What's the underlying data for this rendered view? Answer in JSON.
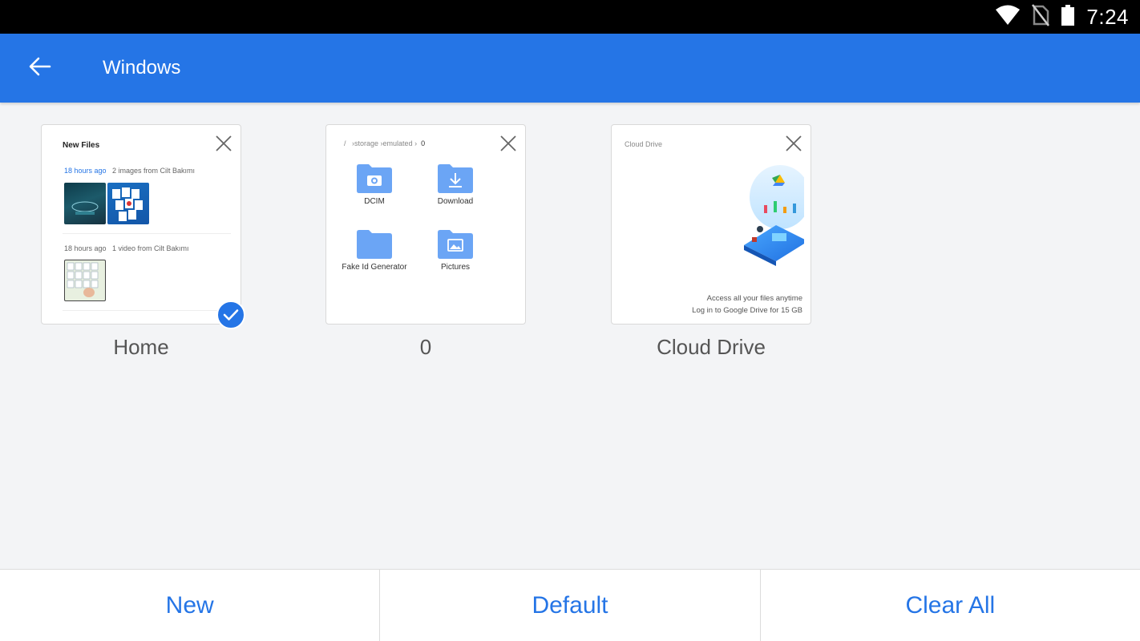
{
  "status_bar": {
    "time": "7:24",
    "icons": [
      "wifi-icon",
      "no-sim-icon",
      "battery-icon"
    ]
  },
  "app_bar": {
    "title": "Windows",
    "back_icon": "arrow-back-icon"
  },
  "windows": [
    {
      "label": "Home",
      "selected": true,
      "preview": {
        "title": "New Files",
        "groups": [
          {
            "time": "18 hours ago",
            "description": "2 images from Cilt Bakımı"
          },
          {
            "time": "18 hours ago",
            "description": "1 video from Cilt Bakımı"
          }
        ]
      }
    },
    {
      "label": "0",
      "selected": false,
      "preview": {
        "breadcrumb": [
          "/",
          "storage",
          "emulated",
          "0"
        ],
        "folders": [
          "DCIM",
          "Download",
          "Fake Id Generator",
          "Pictures"
        ]
      }
    },
    {
      "label": "Cloud Drive",
      "selected": false,
      "preview": {
        "title": "Cloud Drive",
        "line1": "Access all your files anytime",
        "line2": "Log in to Google Drive for 15 GB"
      }
    }
  ],
  "bottom_bar": {
    "new_label": "New",
    "default_label": "Default",
    "clear_all_label": "Clear All"
  },
  "colors": {
    "accent": "#2575e6",
    "folder": "#6ba5f5",
    "background": "#f3f4f6"
  }
}
